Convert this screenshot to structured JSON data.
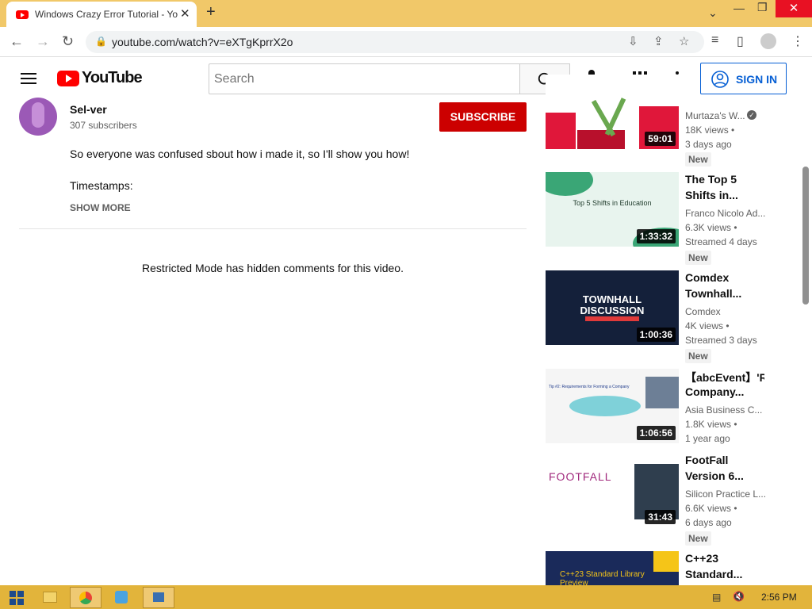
{
  "browser": {
    "tab_title": "Windows Crazy Error Tutorial - YouTube",
    "url": "youtube.com/watch?v=eXTgKprrX2o"
  },
  "header": {
    "logo_text": "YouTube",
    "search_placeholder": "Search",
    "sign_in": "SIGN IN"
  },
  "channel": {
    "name": "Sel-ver",
    "subscribers": "307 subscribers",
    "subscribe_label": "SUBSCRIBE"
  },
  "description": {
    "line1": "So everyone was confused sbout how i made it, so I'll show you how!",
    "line2": "Timestamps:",
    "show_more": "SHOW MORE"
  },
  "comments": {
    "restricted_text": "Restricted Mode has hidden comments for this video."
  },
  "recommendations": [
    {
      "title_line1": "",
      "title_line2": "",
      "channel": "Murtaza's W...",
      "verified": true,
      "meta1": "18K views •",
      "meta2": "3 days ago",
      "badge": "New",
      "duration": "59:01",
      "thumb_color": "#ffffff",
      "accent": "#e0173a"
    },
    {
      "title_line1": "The Top 5",
      "title_line2": "Shifts in...",
      "channel": "Franco Nicolo Ad...",
      "meta1": "6.3K views •",
      "meta2": "Streamed 4 days",
      "badge": "New",
      "duration": "1:33:32",
      "thumb_color": "#e8f4ee",
      "thumb_text": "Top 5 Shifts in Education"
    },
    {
      "title_line1": "Comdex",
      "title_line2": "Townhall...",
      "channel": "Comdex",
      "meta1": "4K views •",
      "meta2": "Streamed 3 days",
      "badge": "New",
      "duration": "1:00:36",
      "thumb_color": "#14203a",
      "thumb_text": "TOWNHALL DISCUSSION"
    },
    {
      "title_line1": "【abcEvent】'RE",
      "title_line2": "Company...",
      "channel": "Asia Business C...",
      "meta1": "1.8K views •",
      "meta2": "1 year ago",
      "badge": "",
      "duration": "1:06:56",
      "thumb_color": "#f5f5f5",
      "thumb_text": "Tip #2: Requirements for Forming a Company"
    },
    {
      "title_line1": "FootFall",
      "title_line2": "Version 6...",
      "channel": "Silicon Practice L...",
      "meta1": "6.6K views •",
      "meta2": "6 days ago",
      "badge": "New",
      "duration": "31:43",
      "thumb_color": "#ffffff",
      "thumb_text": "FOOTFALL"
    },
    {
      "title_line1": "C++23",
      "title_line2": "Standard...",
      "channel": "",
      "meta1": "",
      "meta2": "",
      "badge": "",
      "duration": "",
      "thumb_color": "#1a2a5a",
      "thumb_text": "C++23 Standard Library Preview"
    }
  ],
  "taskbar": {
    "time": "2:56 PM"
  },
  "colors": {
    "titlebar": "#f1c869",
    "youtube_red": "#ff0000",
    "subscribe": "#cc0000",
    "taskbar": "#e2b43b",
    "link_blue": "#065fd4"
  }
}
